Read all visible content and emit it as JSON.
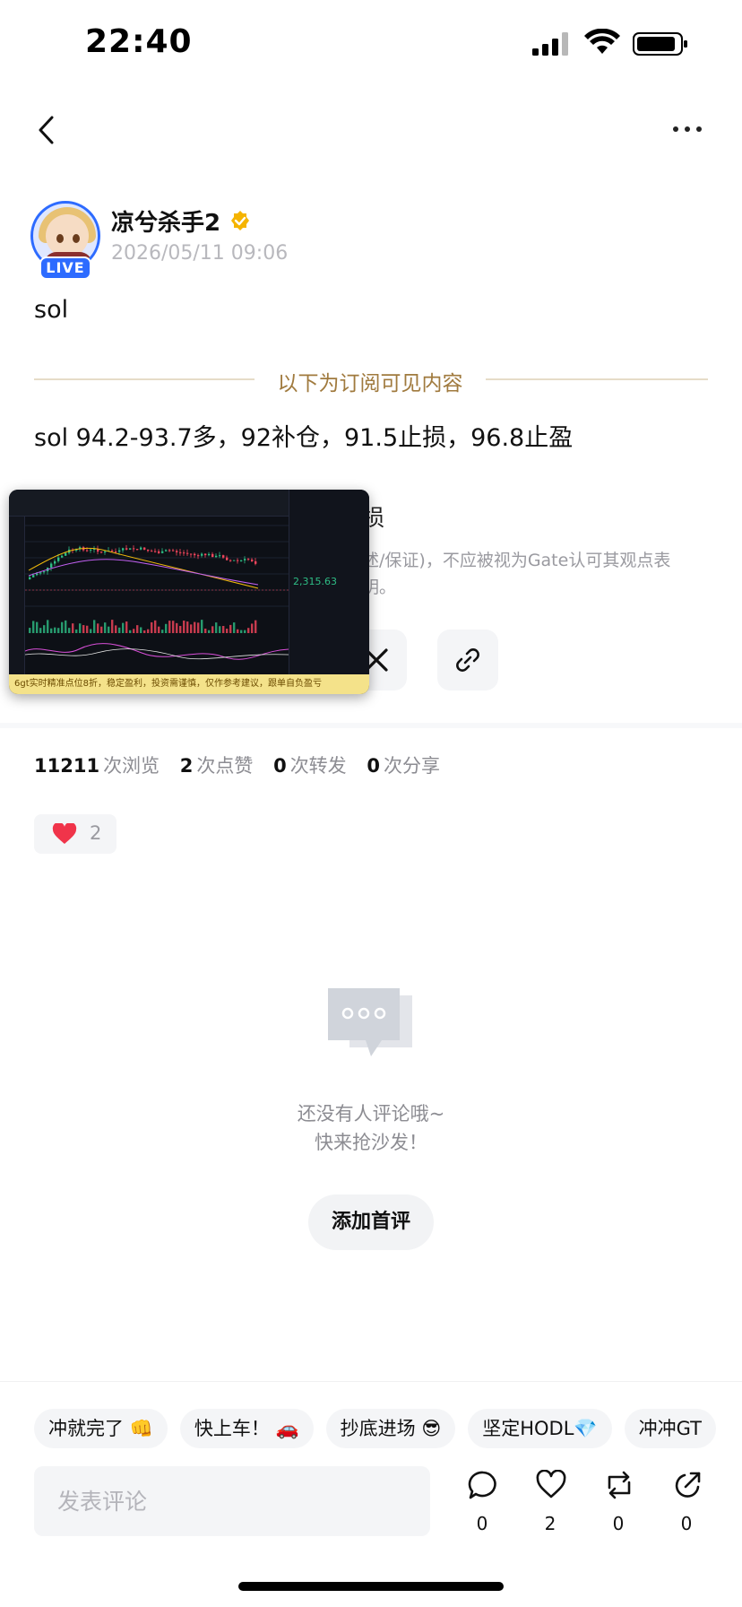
{
  "status_bar": {
    "time": "22:40"
  },
  "author": {
    "name": "凉兮杀手2",
    "date": "2026/05/11 09:06",
    "live_label": "LIVE"
  },
  "post": {
    "title": "sol",
    "divider_text": "以下为订阅可见内容",
    "body": "sol 94.2-93.7多，92补仓，91.5止损，96.8止盈",
    "hidden_title_partial": "损",
    "disclaimer_line1": "述/保证)，不应被视为Gate认可其观点表",
    "disclaimer_line2": "明。"
  },
  "chart_thumbnail": {
    "ticker_text": "6gt实时精准点位8折，稳定盈利，投资需谨慎，仅作参考建议，跟单自负盈亏",
    "price_label": "2,315.63"
  },
  "stats": [
    {
      "count": "11211",
      "label": "次浏览"
    },
    {
      "count": "2",
      "label": "次点赞"
    },
    {
      "count": "0",
      "label": "次转发"
    },
    {
      "count": "0",
      "label": "次分享"
    }
  ],
  "reaction": {
    "count": "2"
  },
  "empty_state": {
    "line1": "还没有人评论哦~",
    "line2": "快来抢沙发！",
    "button": "添加首评"
  },
  "quick_replies": [
    "冲就完了 👊",
    "快上车！ 🚗",
    "抄底进场 😎",
    "坚定HODL💎",
    "冲冲GT"
  ],
  "comment_input": {
    "placeholder": "发表评论"
  },
  "actions": [
    {
      "icon": "comment-icon",
      "count": "0"
    },
    {
      "icon": "heart-icon",
      "count": "2"
    },
    {
      "icon": "repost-icon",
      "count": "0"
    },
    {
      "icon": "share-icon",
      "count": "0"
    }
  ],
  "colors": {
    "accent_blue": "#2d6bff",
    "divider_gold": "#a07a3e",
    "heart_red": "#f0344a",
    "verified_gold": "#f5b400"
  }
}
